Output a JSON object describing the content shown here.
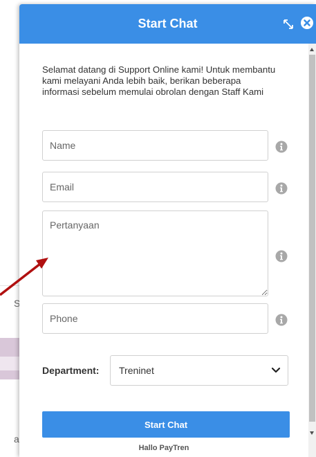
{
  "background": {
    "fragment_1": "Si",
    "fragment_2": "a"
  },
  "widget": {
    "title": "Start Chat",
    "resize_icon": "resize-icon",
    "close_icon": "close-circle-icon",
    "intro_text": "Selamat datang di Support Online kami! Untuk membantu kami melayani Anda lebih baik, berikan beberapa informasi sebelum memulai obrolan dengan Staff Kami",
    "fields": {
      "name_placeholder": "Name",
      "email_placeholder": "Email",
      "question_placeholder": "Pertanyaan",
      "phone_placeholder": "Phone"
    },
    "info_icon": "info-icon",
    "department": {
      "label": "Department:",
      "selected": "Treninet"
    },
    "submit_label": "Start Chat",
    "footer_text": "Hallo PayTren"
  },
  "colors": {
    "header": "#3a8ee6",
    "button": "#3a8ee6",
    "annotation_arrow": "#b01010"
  }
}
